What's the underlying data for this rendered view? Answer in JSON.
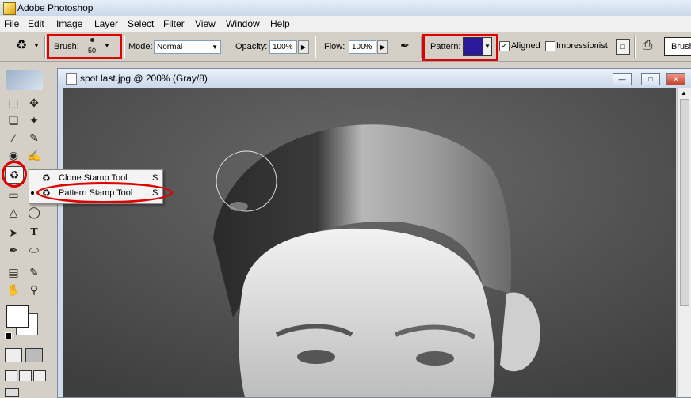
{
  "app": {
    "title": "Adobe Photoshop"
  },
  "menu": [
    "File",
    "Edit",
    "Image",
    "Layer",
    "Select",
    "Filter",
    "View",
    "Window",
    "Help"
  ],
  "options": {
    "brush_label": "Brush:",
    "brush_size": "50",
    "mode_label": "Mode:",
    "mode_value": "Normal",
    "opacity_label": "Opacity:",
    "opacity_value": "100%",
    "flow_label": "Flow:",
    "flow_value": "100%",
    "pattern_label": "Pattern:",
    "aligned_label": "Aligned",
    "aligned_checked": true,
    "impressionist_label": "Impressionist",
    "impressionist_checked": false,
    "brushes_tab": "Brush"
  },
  "document": {
    "title": "spot last.jpg @ 200% (Gray/8)"
  },
  "flyout": [
    {
      "label": "Clone Stamp Tool",
      "shortcut": "S"
    },
    {
      "label": "Pattern Stamp Tool",
      "shortcut": "S"
    }
  ],
  "colors": {
    "highlight": "#e00000",
    "pattern_swatch": "#2a1a9a"
  }
}
